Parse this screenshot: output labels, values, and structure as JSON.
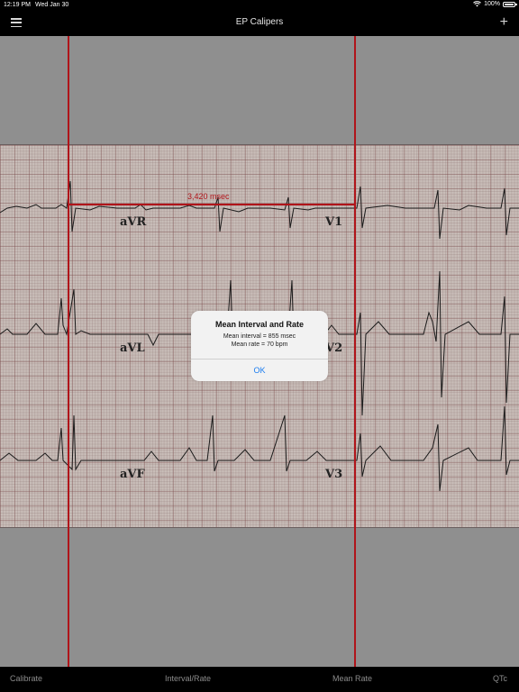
{
  "status_bar": {
    "time": "12:19 PM",
    "date": "Wed Jan 30",
    "battery": "100%"
  },
  "nav": {
    "title": "EP Calipers",
    "menu_icon": "hamburger-menu-icon",
    "add_icon": "plus-icon"
  },
  "ecg": {
    "leads": [
      "aVR",
      "V1",
      "aVL",
      "V2",
      "aVF",
      "V3"
    ]
  },
  "caliper": {
    "measurement": "3,420 msec",
    "color": "#b0141a"
  },
  "alert": {
    "title": "Mean Interval and Rate",
    "line1": "Mean interval = 855 msec",
    "line2": "Mean rate = 70 bpm",
    "ok_label": "OK"
  },
  "toolbar": {
    "items": [
      "Calibrate",
      "Interval/Rate",
      "Mean Rate",
      "QTc"
    ]
  }
}
